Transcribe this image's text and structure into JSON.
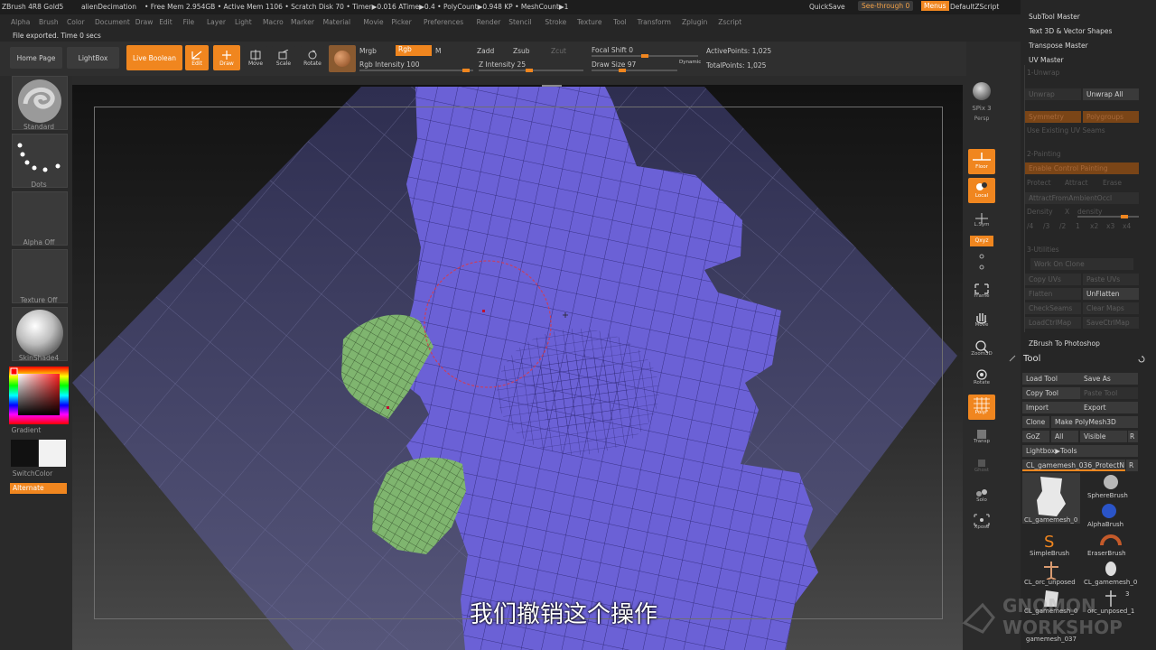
{
  "titlebar": {
    "app": "ZBrush 4R8 Gold5",
    "doc": "alienDecimation",
    "stats": "• Free Mem 2.954GB • Active Mem 1106 • Scratch Disk 70 • Timer▶0.016 ATime▶0.4 • PolyCount▶0.948 KP • MeshCount▶1",
    "quicksave": "QuickSave",
    "seethrough": "See-through  0",
    "menus": "Menus",
    "zscript": "DefaultZScript"
  },
  "menubar": [
    "Alpha",
    "Brush",
    "Color",
    "Document",
    "Draw",
    "Edit",
    "File",
    "Layer",
    "Light",
    "Macro",
    "Marker",
    "Material",
    "Movie",
    "Picker",
    "Preferences",
    "Render",
    "Stencil",
    "Stroke",
    "Texture",
    "Tool",
    "Transform",
    "Zplugin",
    "Zscript"
  ],
  "note": "File exported. Time 0 secs",
  "shelf": {
    "home": "Home Page",
    "lightbox": "LightBox",
    "liveboolean": "Live Boolean",
    "edit": "Edit",
    "draw": "Draw",
    "move": "Move",
    "scale": "Scale",
    "rotate": "Rotate",
    "mrgb": "Mrgb",
    "rgb": "Rgb",
    "m": "M",
    "zadd": "Zadd",
    "zsub": "Zsub",
    "zcut": "Zcut",
    "rgb_intensity": "Rgb Intensity 100",
    "z_intensity": "Z Intensity 25",
    "focal_shift": "Focal Shift 0",
    "draw_size": "Draw Size 97",
    "dynamic": "Dynamic",
    "active_points": "ActivePoints: 1,025",
    "total_points": "TotalPoints: 1,025"
  },
  "lefttray": {
    "brush": "Standard",
    "stroke": "Dots",
    "alpha": "Alpha Off",
    "texture": "Texture Off",
    "material": "SkinShade4",
    "gradient": "Gradient",
    "switchcolor": "SwitchColor",
    "alternate": "Alternate"
  },
  "dock": {
    "bpr": "BPR",
    "spix": "SPix 3",
    "persp": "Persp",
    "floor": "Floor",
    "local": "Local",
    "lsym": "L.Sym",
    "xyz": "Qxyz",
    "frame": "Frame",
    "move": "Move",
    "zoom3d": "Zoom3D",
    "rotate": "Rotate",
    "polyf": "PolyF",
    "transp": "Transp",
    "ghost": "Ghost",
    "solo": "Solo",
    "xpose": "Xpose"
  },
  "rightpanel": {
    "subtool_master": "SubTool Master",
    "text3d": "Text 3D & Vector Shapes",
    "transpose_master": "Transpose Master",
    "uv_master": "UV Master",
    "unwrap_hdr": "1-Unwrap",
    "unwrap": "Unwrap",
    "unwrap_all": "Unwrap All",
    "symmetry": "Symmetry",
    "polygroups": "Polygroups",
    "use_seams": "Use Existing UV Seams",
    "painting_hdr": "2-Painting",
    "enable_painting": "Enable Control Painting",
    "protect": "Protect",
    "attract": "Attract",
    "erase": "Erase",
    "attract_ao": "AttractFromAmbientOccl",
    "density": "Density",
    "x": "X",
    "density2": "density",
    "density_vals": [
      "/4",
      "/3",
      "/2",
      "1",
      "x2",
      "x3",
      "x4"
    ],
    "utilities_hdr": "3-Utilities",
    "work_clone": "Work On Clone",
    "copy_uvs": "Copy UVs",
    "paste_uvs": "Paste UVs",
    "flatten": "Flatten",
    "unflatten": "UnFlatten",
    "check_seams": "CheckSeams",
    "clear_maps": "Clear Maps",
    "load_ctrl": "LoadCtrlMap",
    "save_ctrl": "SaveCtrlMap",
    "zb_photoshop": "ZBrush To Photoshop",
    "tool": "Tool",
    "load_tool": "Load Tool",
    "save_as": "Save As",
    "copy_tool": "Copy Tool",
    "paste_tool": "Paste Tool",
    "import": "Import",
    "export": "Export",
    "clone": "Clone",
    "make_polymesh": "Make PolyMesh3D",
    "goz": "GoZ",
    "all": "All",
    "visible": "Visible",
    "r": "R",
    "lightbox_tools": "Lightbox▶Tools",
    "current_tool": "CL_gamemesh_036_ProtectN",
    "thumbs": [
      {
        "label": "CL_gamemesh_0"
      },
      {
        "label": "SphereBrush"
      },
      {
        "label": "AlphaBrush"
      },
      {
        "label": "SimpleBrush"
      },
      {
        "label": "EraserBrush"
      },
      {
        "label": "CL_orc_unposed"
      },
      {
        "label": "CL_gamemesh_0"
      },
      {
        "label": "CL_gamemesh_0"
      },
      {
        "label": "orc_unposed_1"
      },
      {
        "label": "gamemesh_037"
      }
    ],
    "thumb_count": "3"
  },
  "subtitle": "我们撤销这个操作",
  "colors": {
    "accent": "#f0861f",
    "mesh_blue": "#6b61d6",
    "mesh_green": "#7fb56f",
    "brush_circle": "#d83a4b"
  }
}
